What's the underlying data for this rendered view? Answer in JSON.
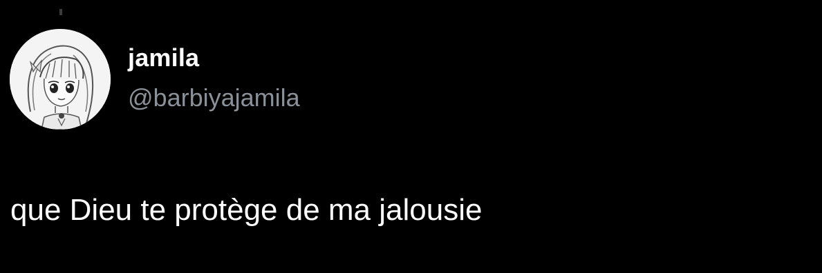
{
  "tweet": {
    "author": {
      "display_name": "jamila",
      "handle": "@barbiyajamila",
      "avatar_icon": "anime-girl-avatar-icon"
    },
    "text": "que Dieu te protège de ma jalousie"
  },
  "colors": {
    "background": "#000000",
    "primary_text": "#ffffff",
    "secondary_text": "#8b9198"
  }
}
